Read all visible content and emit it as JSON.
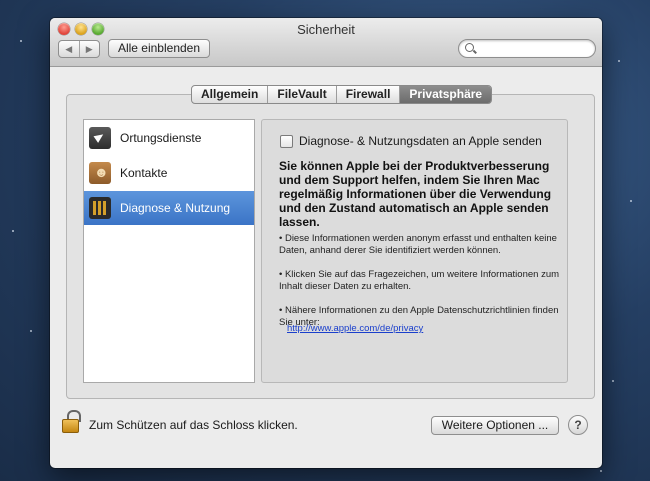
{
  "window": {
    "title": "Sicherheit"
  },
  "toolbar": {
    "back": "◀",
    "forward": "▶",
    "show_all": "Alle einblenden",
    "search_placeholder": ""
  },
  "tabs": [
    {
      "label": "Allgemein"
    },
    {
      "label": "FileVault"
    },
    {
      "label": "Firewall"
    },
    {
      "label": "Privatsphäre",
      "active": true
    }
  ],
  "sidebar": {
    "items": [
      {
        "label": "Ortungsdienste",
        "icon": "location-arrow-icon"
      },
      {
        "label": "Kontakte",
        "icon": "contacts-book-icon"
      },
      {
        "label": "Diagnose & Nutzung",
        "icon": "diagnostics-icon",
        "selected": true
      }
    ]
  },
  "content": {
    "checkbox_label": "Diagnose- & Nutzungsdaten an Apple senden",
    "checkbox_checked": false,
    "intro": "Sie können Apple bei der Produktverbesserung und dem Support helfen, indem Sie Ihren Mac regelmäßig Informationen über die Verwendung und den Zustand automatisch an Apple senden lassen.",
    "bullet1": "• Diese Informationen werden anonym erfasst und enthalten keine Daten, anhand derer Sie identifiziert werden können.",
    "bullet2": "• Klicken Sie auf das Fragezeichen, um weitere Informationen zum Inhalt dieser Daten zu erhalten.",
    "bullet3": "• Nähere Informationen zu den Apple Datenschutzrichtlinien finden Sie unter:",
    "link": "http://www.apple.com/de/privacy"
  },
  "footer": {
    "lock_text": "Zum Schützen auf das Schloss klicken.",
    "more_options": "Weitere Optionen ...",
    "help": "?"
  }
}
